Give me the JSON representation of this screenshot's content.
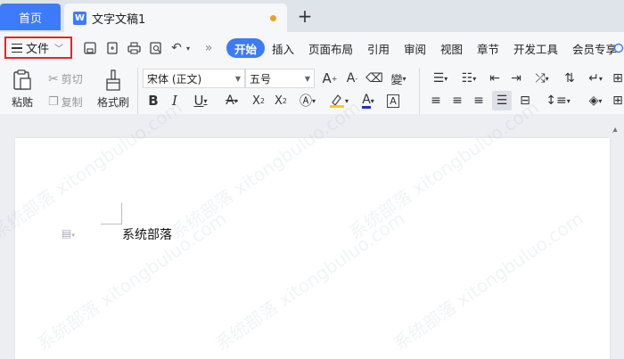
{
  "tabs": {
    "home_label": "首页",
    "doc_label": "文字文稿1",
    "doc_icon": "W"
  },
  "header": {
    "file_label": "文件",
    "menu_tabs": [
      "开始",
      "插入",
      "页面布局",
      "引用",
      "审阅",
      "视图",
      "章节",
      "开发工具",
      "会员专享"
    ]
  },
  "ribbon": {
    "paste_label": "粘贴",
    "cut_label": "剪切",
    "copy_label": "复制",
    "format_painter_label": "格式刷",
    "font_name": "宋体 (正文)",
    "font_size": "五号"
  },
  "document": {
    "body_text": "系统部落"
  },
  "watermark": {
    "text": "系统部落 xitongbuluo.com"
  },
  "colors": {
    "accent": "#3e7bfa",
    "highlight_box": "#e0262b",
    "font_color_underline": "#2030c0",
    "highlight_color": "#f0d020"
  }
}
